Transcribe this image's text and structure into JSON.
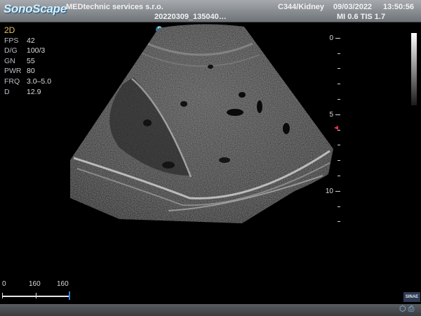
{
  "header": {
    "brand": "SonoScape",
    "hospital": "MEDtechnic services s.r.o.",
    "patient_id": "20220309_135040…",
    "probe_preset": "C344/Kidney",
    "date": "09/03/2022",
    "time": "13:50:56",
    "indices": "MI 0.6 TIS 1.7"
  },
  "params": {
    "mode": "2D",
    "rows": [
      {
        "key": "FPS",
        "value": "42"
      },
      {
        "key": "D/G",
        "value": "100/3"
      },
      {
        "key": "GN",
        "value": "55"
      },
      {
        "key": "PWR",
        "value": "80"
      },
      {
        "key": "FRQ",
        "value": "3.0–5.0"
      },
      {
        "key": "D",
        "value": "12.9"
      }
    ]
  },
  "depth_scale": {
    "labels": [
      "0",
      "5",
      "10"
    ]
  },
  "ruler": {
    "labels": [
      "0",
      "160",
      "160"
    ]
  },
  "orientation_marker": "S",
  "badge": "SINAE",
  "colors": {
    "focus_marker": "#e0314a",
    "depth_ruler_marker": "#3a79d6",
    "mode_label": "#e7c06a"
  },
  "icons": [
    "orientation-marker-icon",
    "depth-focus-marker-icon",
    "grayscale-bar-icon",
    "usb-icon",
    "printer-icon"
  ]
}
